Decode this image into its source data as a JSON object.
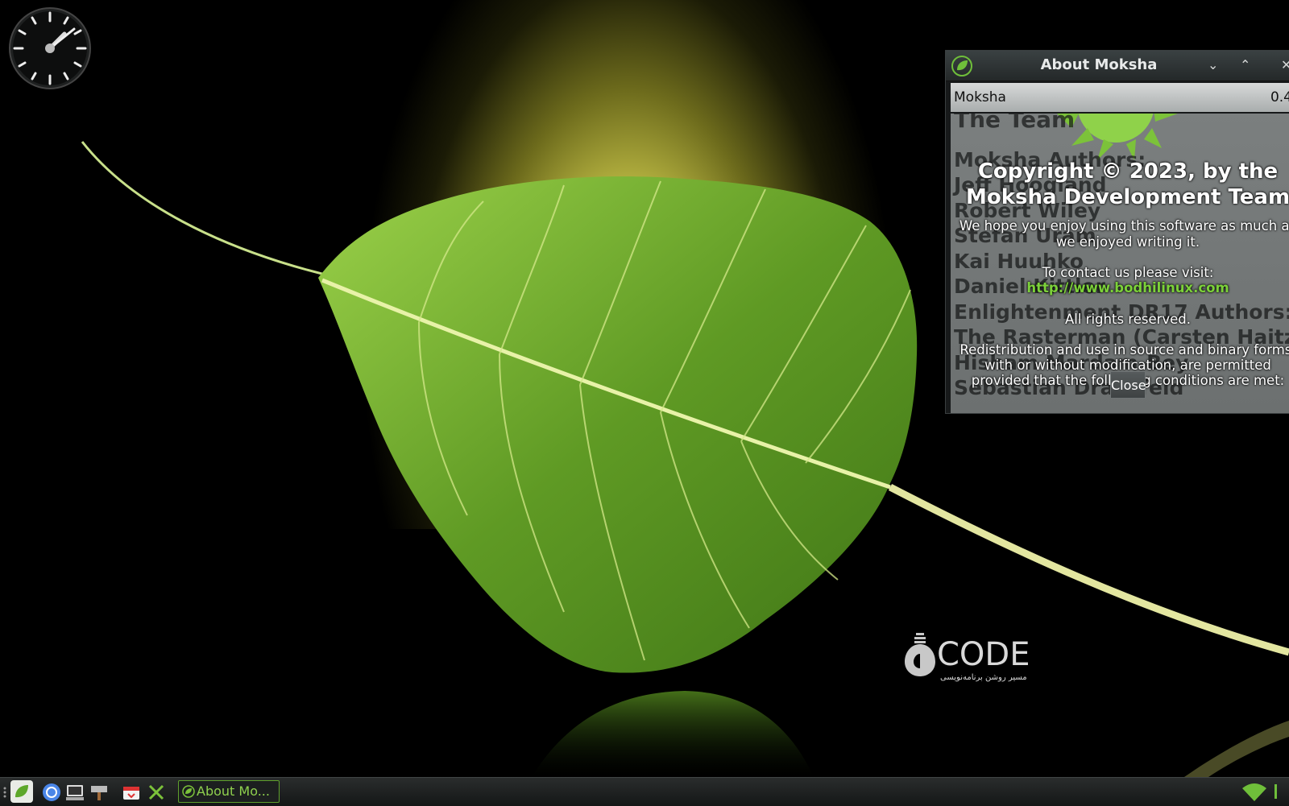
{
  "dialog": {
    "title": "About Moksha",
    "app_name": "Moksha",
    "version": "0.4",
    "copyright_line1": "Copyright © 2023, by the",
    "copyright_line2": "Moksha Development Team",
    "hope_line1": "We hope you enjoy using this software as much as",
    "hope_line2": "we enjoyed writing it.",
    "contact": "To contact us please visit:",
    "url": "http://www.bodhilinux.com",
    "rights": "All rights reserved.",
    "license_line1": "Redistribution and use in source and binary forms,",
    "license_line2": "with or without modification, are permitted",
    "license_line3": "provided that the following conditions are met:",
    "close_label": "Close",
    "credits": {
      "heading": "The Team",
      "section1": "Moksha Authors:",
      "names1": [
        "Jeff Hoogland",
        "Robert Wiley",
        "Stefan Uram",
        "Kai Huuhko",
        "Daniel Kittler"
      ],
      "section2": "Enlightenment DR17 Authors:",
      "names2": [
        "The Rasterman (Carsten Haitzler)",
        "Hisham Mardam-Bey",
        "Sebastian Dransfeld"
      ]
    }
  },
  "watermark": {
    "brand": "CODE",
    "tagline": "مسیر روشن برنامه‌نویسی"
  },
  "taskbar": {
    "task_label": "About Mo...",
    "launchers": [
      "bodhi-menu-icon",
      "chromium-icon",
      "terminal-icon",
      "file-manager-icon",
      "software-center-icon",
      "settings-tools-icon"
    ],
    "tray": [
      "wifi-icon"
    ]
  },
  "colors": {
    "accent_green": "#7cd13a",
    "leaf_green": "#6aa630",
    "glow_yellow": "#f6f48a"
  }
}
